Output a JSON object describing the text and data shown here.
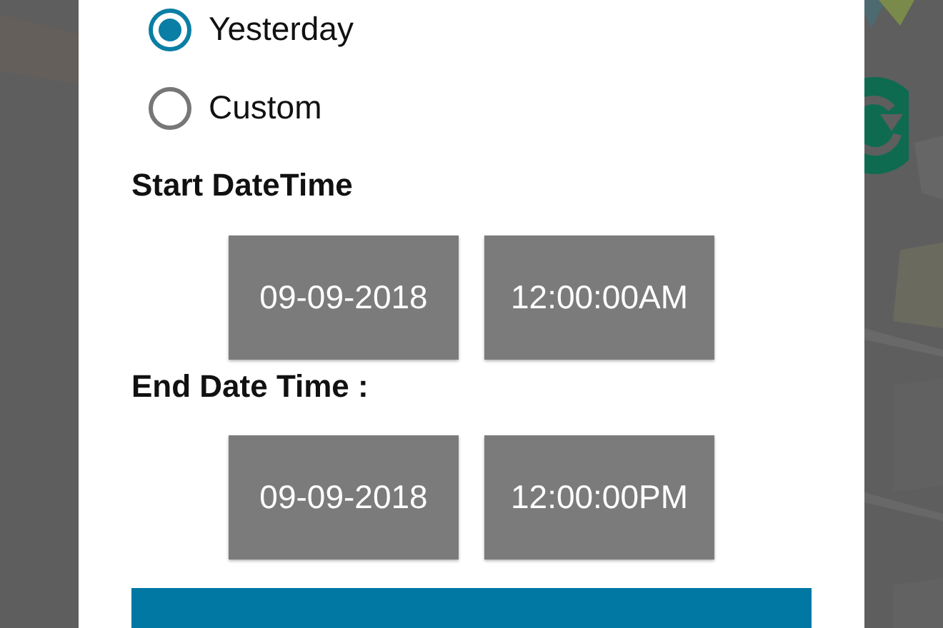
{
  "range_options": [
    {
      "label": "Yesterday",
      "selected": true
    },
    {
      "label": "Custom",
      "selected": false
    }
  ],
  "start": {
    "label": "Start DateTime",
    "date": "09-09-2018",
    "time": "12:00:00AM"
  },
  "end": {
    "label": "End Date Time :",
    "date": "09-09-2018",
    "time": "12:00:00PM"
  }
}
